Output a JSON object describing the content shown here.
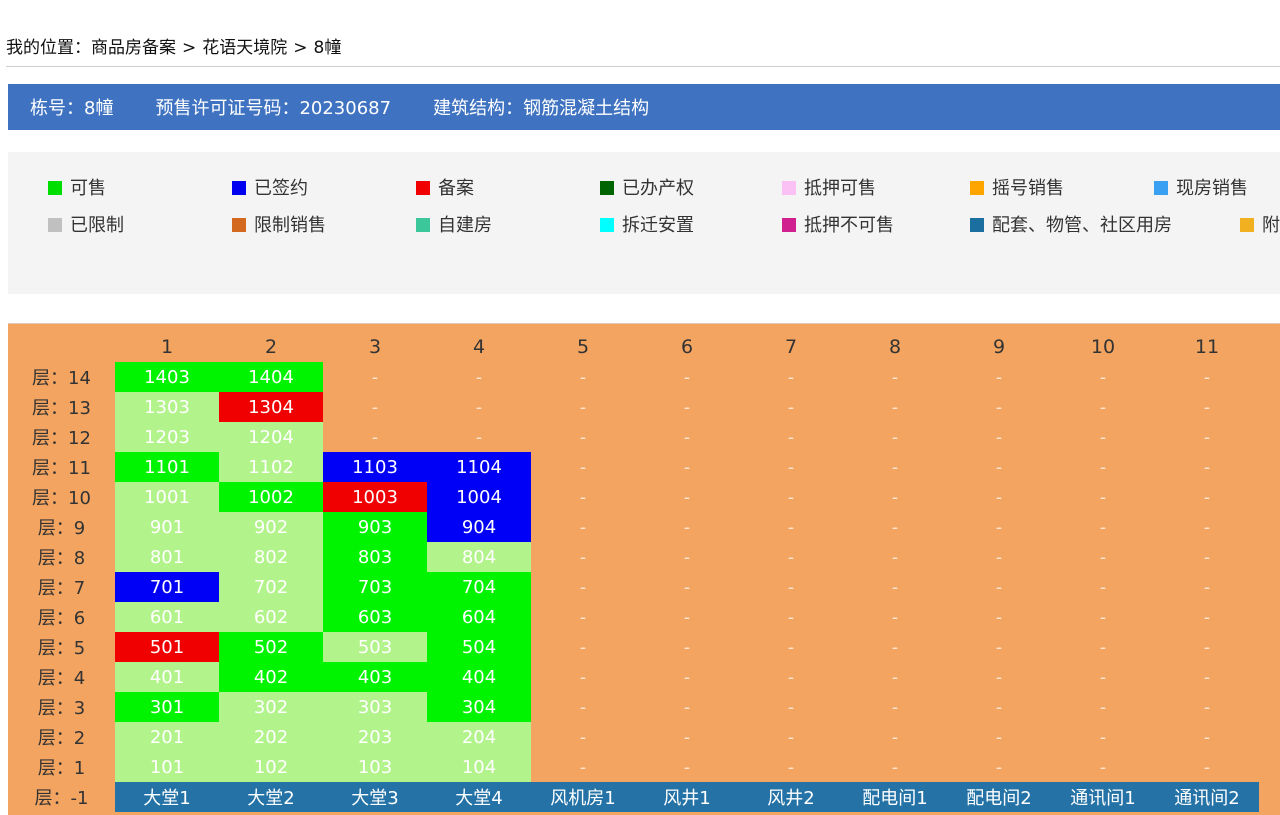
{
  "breadcrumb": {
    "prefix": "我的位置：",
    "items": [
      "商品房备案",
      "花语天境院",
      "8幢"
    ],
    "separator": ">"
  },
  "info": {
    "building": "栋号：8幢",
    "permit": "预售许可证号码：20230687",
    "structure": "建筑结构：钢筋混凝土结构"
  },
  "legend": [
    {
      "label": "可售",
      "color": "#00dd00"
    },
    {
      "label": "已签约",
      "color": "#0000f0"
    },
    {
      "label": "备案",
      "color": "#f00000"
    },
    {
      "label": "已办产权",
      "color": "#006400"
    },
    {
      "label": "抵押可售",
      "color": "#fbc0f4"
    },
    {
      "label": "摇号销售",
      "color": "#ffa500"
    },
    {
      "label": "现房销售",
      "color": "#3aa0f2"
    },
    {
      "label": "已限制",
      "color": "#c0c0c0"
    },
    {
      "label": "限制销售",
      "color": "#d2691e"
    },
    {
      "label": "自建房",
      "color": "#3cc79a"
    },
    {
      "label": "拆迁安置",
      "color": "#00ffff"
    },
    {
      "label": "抵押不可售",
      "color": "#d02090"
    },
    {
      "label": "配套、物管、社区用房",
      "color": "#1b6fa0"
    },
    {
      "label": "附",
      "color": "#f0b020"
    }
  ],
  "columns": [
    "1",
    "2",
    "3",
    "4",
    "5",
    "6",
    "7",
    "8",
    "9",
    "10",
    "11"
  ],
  "floors": [
    {
      "label": "层：14",
      "cells": [
        [
          "1403",
          "sale"
        ],
        [
          "1404",
          "sale"
        ],
        [
          "-",
          "none"
        ],
        [
          "-",
          "none"
        ],
        [
          "-",
          "none"
        ],
        [
          "-",
          "none"
        ],
        [
          "-",
          "none"
        ],
        [
          "-",
          "none"
        ],
        [
          "-",
          "none"
        ],
        [
          "-",
          "none"
        ],
        [
          "-",
          "none"
        ]
      ]
    },
    {
      "label": "层：13",
      "cells": [
        [
          "1303",
          "lite"
        ],
        [
          "1304",
          "filed"
        ],
        [
          "-",
          "none"
        ],
        [
          "-",
          "none"
        ],
        [
          "-",
          "none"
        ],
        [
          "-",
          "none"
        ],
        [
          "-",
          "none"
        ],
        [
          "-",
          "none"
        ],
        [
          "-",
          "none"
        ],
        [
          "-",
          "none"
        ],
        [
          "-",
          "none"
        ]
      ]
    },
    {
      "label": "层：12",
      "cells": [
        [
          "1203",
          "lite"
        ],
        [
          "1204",
          "lite"
        ],
        [
          "-",
          "none"
        ],
        [
          "-",
          "none"
        ],
        [
          "-",
          "none"
        ],
        [
          "-",
          "none"
        ],
        [
          "-",
          "none"
        ],
        [
          "-",
          "none"
        ],
        [
          "-",
          "none"
        ],
        [
          "-",
          "none"
        ],
        [
          "-",
          "none"
        ]
      ]
    },
    {
      "label": "层：11",
      "cells": [
        [
          "1101",
          "sale"
        ],
        [
          "1102",
          "lite"
        ],
        [
          "1103",
          "signed"
        ],
        [
          "1104",
          "signed"
        ],
        [
          "-",
          "none"
        ],
        [
          "-",
          "none"
        ],
        [
          "-",
          "none"
        ],
        [
          "-",
          "none"
        ],
        [
          "-",
          "none"
        ],
        [
          "-",
          "none"
        ],
        [
          "-",
          "none"
        ]
      ]
    },
    {
      "label": "层：10",
      "cells": [
        [
          "1001",
          "lite"
        ],
        [
          "1002",
          "sale"
        ],
        [
          "1003",
          "filed"
        ],
        [
          "1004",
          "signed"
        ],
        [
          "-",
          "none"
        ],
        [
          "-",
          "none"
        ],
        [
          "-",
          "none"
        ],
        [
          "-",
          "none"
        ],
        [
          "-",
          "none"
        ],
        [
          "-",
          "none"
        ],
        [
          "-",
          "none"
        ]
      ]
    },
    {
      "label": "层：9",
      "cells": [
        [
          "901",
          "lite"
        ],
        [
          "902",
          "lite"
        ],
        [
          "903",
          "sale"
        ],
        [
          "904",
          "signed"
        ],
        [
          "-",
          "none"
        ],
        [
          "-",
          "none"
        ],
        [
          "-",
          "none"
        ],
        [
          "-",
          "none"
        ],
        [
          "-",
          "none"
        ],
        [
          "-",
          "none"
        ],
        [
          "-",
          "none"
        ]
      ]
    },
    {
      "label": "层：8",
      "cells": [
        [
          "801",
          "lite"
        ],
        [
          "802",
          "lite"
        ],
        [
          "803",
          "sale"
        ],
        [
          "804",
          "lite"
        ],
        [
          "-",
          "none"
        ],
        [
          "-",
          "none"
        ],
        [
          "-",
          "none"
        ],
        [
          "-",
          "none"
        ],
        [
          "-",
          "none"
        ],
        [
          "-",
          "none"
        ],
        [
          "-",
          "none"
        ]
      ]
    },
    {
      "label": "层：7",
      "cells": [
        [
          "701",
          "signed"
        ],
        [
          "702",
          "lite"
        ],
        [
          "703",
          "sale"
        ],
        [
          "704",
          "sale"
        ],
        [
          "-",
          "none"
        ],
        [
          "-",
          "none"
        ],
        [
          "-",
          "none"
        ],
        [
          "-",
          "none"
        ],
        [
          "-",
          "none"
        ],
        [
          "-",
          "none"
        ],
        [
          "-",
          "none"
        ]
      ]
    },
    {
      "label": "层：6",
      "cells": [
        [
          "601",
          "lite"
        ],
        [
          "602",
          "lite"
        ],
        [
          "603",
          "sale"
        ],
        [
          "604",
          "sale"
        ],
        [
          "-",
          "none"
        ],
        [
          "-",
          "none"
        ],
        [
          "-",
          "none"
        ],
        [
          "-",
          "none"
        ],
        [
          "-",
          "none"
        ],
        [
          "-",
          "none"
        ],
        [
          "-",
          "none"
        ]
      ]
    },
    {
      "label": "层：5",
      "cells": [
        [
          "501",
          "filed"
        ],
        [
          "502",
          "sale"
        ],
        [
          "503",
          "lite"
        ],
        [
          "504",
          "sale"
        ],
        [
          "-",
          "none"
        ],
        [
          "-",
          "none"
        ],
        [
          "-",
          "none"
        ],
        [
          "-",
          "none"
        ],
        [
          "-",
          "none"
        ],
        [
          "-",
          "none"
        ],
        [
          "-",
          "none"
        ]
      ]
    },
    {
      "label": "层：4",
      "cells": [
        [
          "401",
          "lite"
        ],
        [
          "402",
          "sale"
        ],
        [
          "403",
          "sale"
        ],
        [
          "404",
          "sale"
        ],
        [
          "-",
          "none"
        ],
        [
          "-",
          "none"
        ],
        [
          "-",
          "none"
        ],
        [
          "-",
          "none"
        ],
        [
          "-",
          "none"
        ],
        [
          "-",
          "none"
        ],
        [
          "-",
          "none"
        ]
      ]
    },
    {
      "label": "层：3",
      "cells": [
        [
          "301",
          "sale"
        ],
        [
          "302",
          "lite"
        ],
        [
          "303",
          "lite"
        ],
        [
          "304",
          "sale"
        ],
        [
          "-",
          "none"
        ],
        [
          "-",
          "none"
        ],
        [
          "-",
          "none"
        ],
        [
          "-",
          "none"
        ],
        [
          "-",
          "none"
        ],
        [
          "-",
          "none"
        ],
        [
          "-",
          "none"
        ]
      ]
    },
    {
      "label": "层：2",
      "cells": [
        [
          "201",
          "lite"
        ],
        [
          "202",
          "lite"
        ],
        [
          "203",
          "lite"
        ],
        [
          "204",
          "lite"
        ],
        [
          "-",
          "none"
        ],
        [
          "-",
          "none"
        ],
        [
          "-",
          "none"
        ],
        [
          "-",
          "none"
        ],
        [
          "-",
          "none"
        ],
        [
          "-",
          "none"
        ],
        [
          "-",
          "none"
        ]
      ]
    },
    {
      "label": "层：1",
      "cells": [
        [
          "101",
          "lite"
        ],
        [
          "102",
          "lite"
        ],
        [
          "103",
          "lite"
        ],
        [
          "104",
          "lite"
        ],
        [
          "-",
          "none"
        ],
        [
          "-",
          "none"
        ],
        [
          "-",
          "none"
        ],
        [
          "-",
          "none"
        ],
        [
          "-",
          "none"
        ],
        [
          "-",
          "none"
        ],
        [
          "-",
          "none"
        ]
      ]
    },
    {
      "label": "层：-1",
      "cells": [
        [
          "大堂1",
          "base"
        ],
        [
          "大堂2",
          "base"
        ],
        [
          "大堂3",
          "base"
        ],
        [
          "大堂4",
          "base"
        ],
        [
          "风机房1",
          "base"
        ],
        [
          "风井1",
          "base"
        ],
        [
          "风井2",
          "base"
        ],
        [
          "配电间1",
          "base"
        ],
        [
          "配电间2",
          "base"
        ],
        [
          "通讯间1",
          "base"
        ],
        [
          "通讯间2",
          "base"
        ]
      ]
    }
  ]
}
